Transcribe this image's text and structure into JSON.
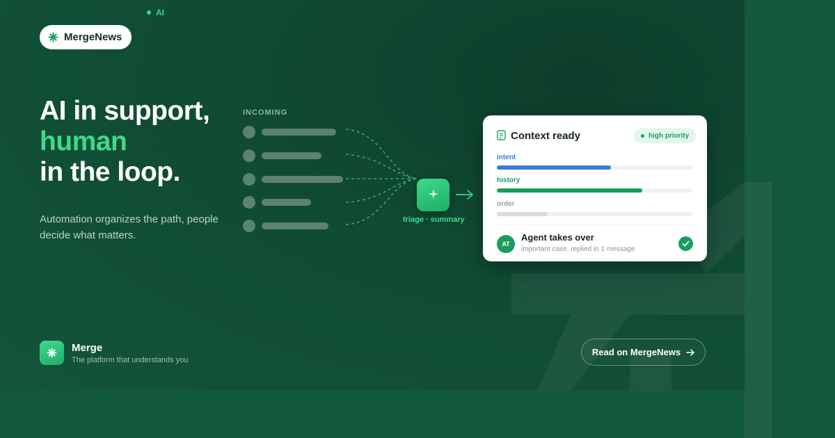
{
  "ai_tag": "AI",
  "brand": {
    "name": "MergeNews",
    "icon": "asterisk-icon"
  },
  "hero": {
    "line1": "AI in support,",
    "line2": "human",
    "line3": "in the loop."
  },
  "subtitle": "Automation organizes the path, people decide what matters.",
  "incoming": {
    "label": "INCOMING"
  },
  "triage": {
    "label": "triage · summary",
    "icon": "sparkle-icon"
  },
  "card": {
    "title": "Context ready",
    "priority": "high priority",
    "metrics": [
      {
        "label": "intent",
        "fraction": 0.58,
        "color": "#3b7bdc"
      },
      {
        "label": "history",
        "fraction": 0.74,
        "color": "#1a9d5c"
      },
      {
        "label": "order",
        "fraction": 0.26,
        "color": "#d6dbd8"
      }
    ],
    "agent": {
      "initials": "AT",
      "title": "Agent takes over",
      "subtitle": "important case, replied in 1 message"
    }
  },
  "footer": {
    "name": "Merge",
    "tagline": "The platform that understands you",
    "cta": "Read on MergeNews",
    "cta_icon": "arrow-right-icon"
  },
  "colors": {
    "accent": "#3ed98d",
    "background": "#104a33",
    "card": "#ffffff"
  }
}
